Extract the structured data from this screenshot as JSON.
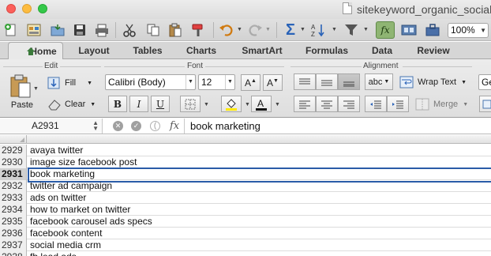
{
  "window": {
    "title": "sitekeyword_organic_socialm"
  },
  "toolbar": {
    "zoom": "100%",
    "icons": [
      "new-workbook-icon",
      "templates-icon",
      "open-icon",
      "save-icon",
      "print-icon",
      "cut-icon",
      "copy-icon",
      "paste-icon",
      "format-painter-icon",
      "undo-icon",
      "redo-icon",
      "autosum-icon",
      "sort-icon",
      "filter-icon",
      "formula-builder-icon",
      "gallery-icon",
      "toolbox-icon"
    ]
  },
  "tabs": [
    {
      "label": "Home",
      "active": true
    },
    {
      "label": "Layout"
    },
    {
      "label": "Tables"
    },
    {
      "label": "Charts"
    },
    {
      "label": "SmartArt"
    },
    {
      "label": "Formulas"
    },
    {
      "label": "Data"
    },
    {
      "label": "Review"
    }
  ],
  "ribbon": {
    "edit": {
      "label": "Edit",
      "paste": "Paste",
      "fill": "Fill",
      "clear": "Clear"
    },
    "font": {
      "label": "Font",
      "family": "Calibri (Body)",
      "size": "12"
    },
    "alignment": {
      "label": "Alignment",
      "text_box": "abc",
      "wrap_text": "Wrap Text",
      "merge": "Merge",
      "number_format_partial": "Ge"
    }
  },
  "formula_bar": {
    "name_box": "A2931",
    "fx": "fx",
    "content": "book marketing"
  },
  "sheet": {
    "rows": [
      {
        "num": "2929",
        "value": "avaya twitter"
      },
      {
        "num": "2930",
        "value": "image size facebook post"
      },
      {
        "num": "2931",
        "value": "book marketing",
        "selected": true
      },
      {
        "num": "2932",
        "value": "twitter ad campaign"
      },
      {
        "num": "2933",
        "value": "ads on twitter"
      },
      {
        "num": "2934",
        "value": "how to market on twitter"
      },
      {
        "num": "2935",
        "value": "facebook carousel ads specs"
      },
      {
        "num": "2936",
        "value": "facebook content"
      },
      {
        "num": "2937",
        "value": "social media crm"
      },
      {
        "num": "2938",
        "value": "fb lead ads"
      }
    ]
  },
  "colors": {
    "selection_border": "#2a5ca8",
    "fx_toggle": "#8fb573"
  }
}
